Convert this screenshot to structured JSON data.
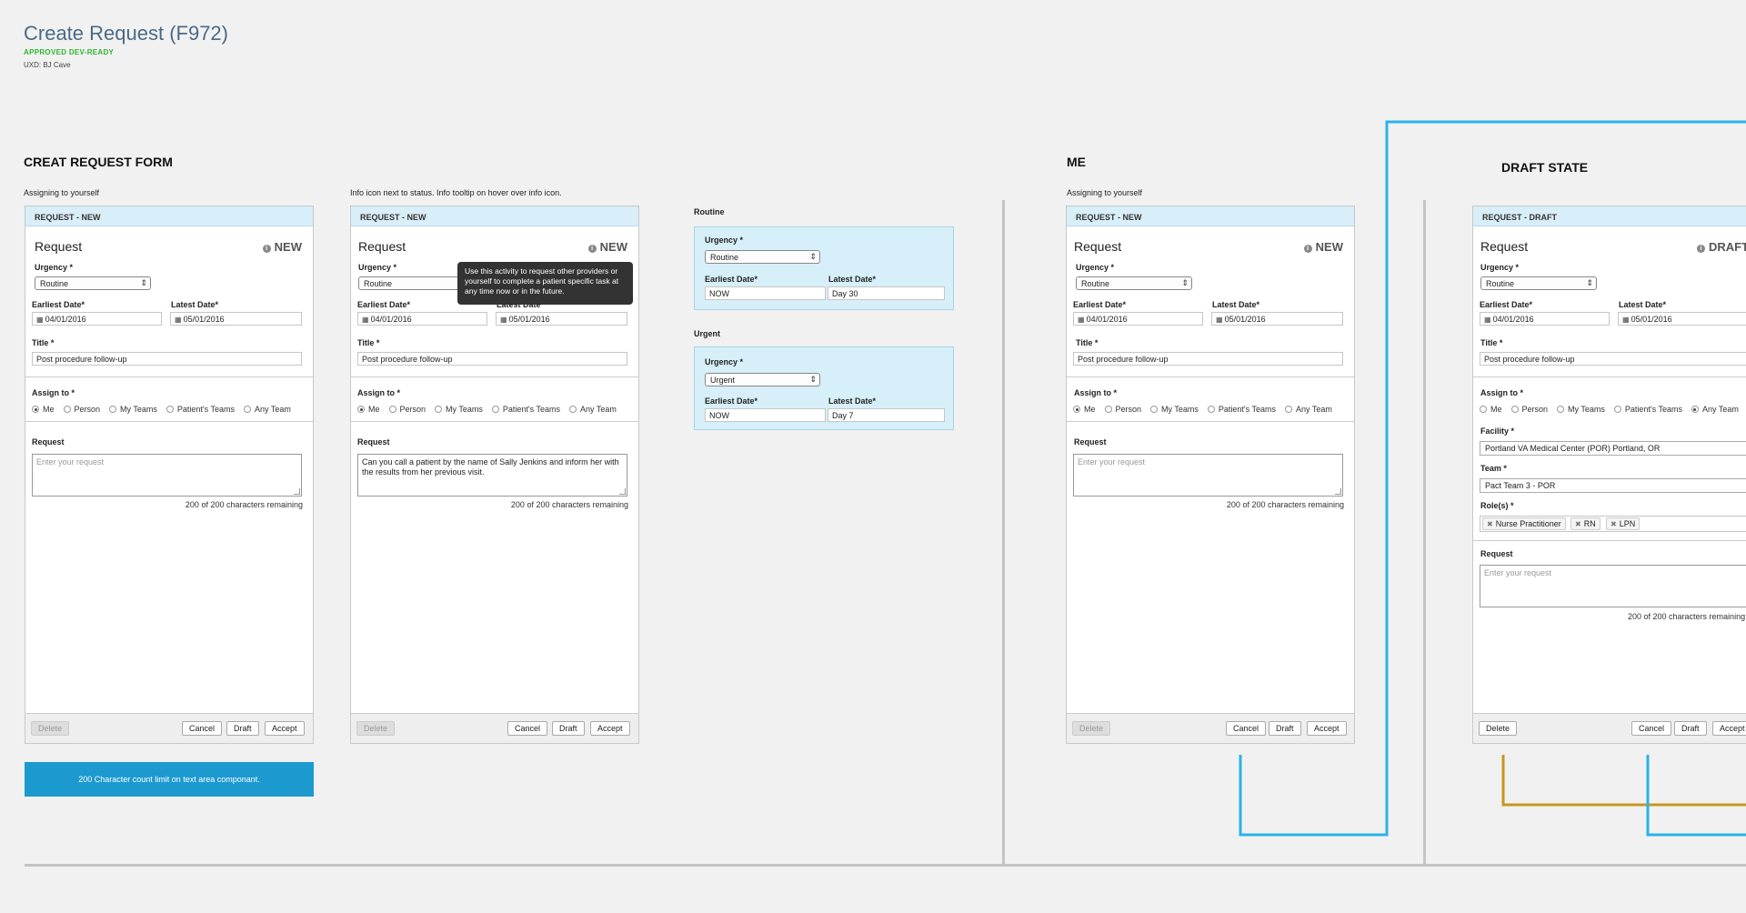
{
  "page": {
    "title": "Create Request (F972)",
    "approved": "APPROVED DEV-READY",
    "uxd": "UXD: BJ Cave"
  },
  "sections": {
    "create_form": "CREAT REQUEST FORM",
    "me": "ME",
    "draft": "DRAFT STATE"
  },
  "notes": {
    "assigning_self_1": "Assigning to yourself",
    "info_note": "Info icon next to status. Info tooltip on hover over info icon.",
    "assigning_self_2": "Assigning to yourself"
  },
  "form": {
    "header_new": "REQUEST - NEW",
    "header_draft": "REQUEST - DRAFT",
    "request_title": "Request",
    "status_new": "NEW",
    "status_draft": "DRAFT",
    "urgency_label": "Urgency",
    "urgency_value": "Routine",
    "earliest_label": "Earliest Date*",
    "latest_label": "Latest Date*",
    "earliest_value": "04/01/2016",
    "latest_value": "05/01/2016",
    "title_label": "Title",
    "title_value": "Post procedure follow-up",
    "assign_label": "Assign to",
    "required": "*",
    "assign_options": [
      "Me",
      "Person",
      "My Teams",
      "Patient's Teams",
      "Any Team"
    ],
    "request_label": "Request",
    "request_placeholder": "Enter your request",
    "request_filled": "Can you call a patient by the name of Sally Jenkins and inform her with the results from her previous visit.",
    "chars_remaining": "200 of 200 characters remaining",
    "delete": "Delete",
    "cancel": "Cancel",
    "draft_btn": "Draft",
    "accept": "Accept"
  },
  "tooltip": "Use this activity to request other providers or yourself to complete a patient specific task at any time now or in the future.",
  "char_limit_note": "200 Character count limit on text area componant.",
  "urgency_samples": [
    {
      "heading": "Routine",
      "urgency": "Routine",
      "earliest": "NOW",
      "latest": "Day 30"
    },
    {
      "heading": "Urgent",
      "urgency": "Urgent",
      "earliest": "NOW",
      "latest": "Day 7"
    }
  ],
  "sample_labels": {
    "urgency": "Urgency",
    "earliest": "Earliest Date*",
    "latest": "Latest Date*"
  },
  "draft_extra": {
    "facility_label": "Facility",
    "facility_value": "Portland VA Medical Center (POR) Portland, OR",
    "team_label": "Team",
    "team_value": "Pact Team 3  - POR",
    "roles_label": "Role(s)",
    "roles": [
      "Nurse Practitioner",
      "RN",
      "LPN"
    ]
  },
  "icons": {
    "info": "info-icon",
    "calendar": "calendar-icon",
    "remove": "remove-tag-icon"
  },
  "colors": {
    "header_bg": "#d8eef8",
    "accent_blue": "#1c9ad0",
    "connector_blue": "#28b3e8",
    "connector_gold": "#c8961e",
    "approved_green": "#2fb52f"
  }
}
